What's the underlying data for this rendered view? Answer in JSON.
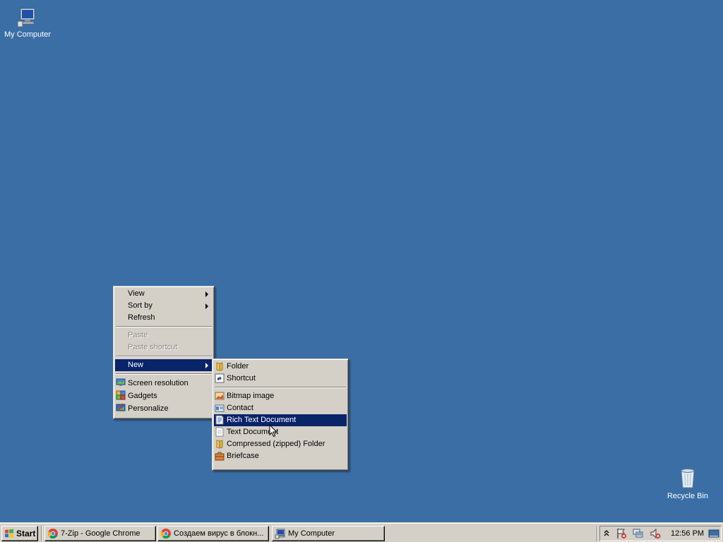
{
  "desktop": {
    "icons": {
      "my_computer": "My Computer",
      "recycle_bin": "Recycle Bin"
    },
    "background_color": "#3a6ea5"
  },
  "context_menu": {
    "view": "View",
    "sort_by": "Sort by",
    "refresh": "Refresh",
    "paste": "Paste",
    "paste_shortcut": "Paste shortcut",
    "new": "New",
    "screen_resolution": "Screen resolution",
    "gadgets": "Gadgets",
    "personalize": "Personalize"
  },
  "new_submenu": {
    "folder": "Folder",
    "shortcut": "Shortcut",
    "bitmap_image": "Bitmap image",
    "contact": "Contact",
    "rich_text_document": "Rich Text Document",
    "text_document": "Text Document",
    "compressed_folder": "Compressed (zipped) Folder",
    "briefcase": "Briefcase"
  },
  "taskbar": {
    "start": "Start",
    "tasks": {
      "t1": "7-Zip - Google Chrome",
      "t2": "Создаем вирус в блокн...",
      "t3": "My Computer"
    },
    "clock": "12:56 PM"
  },
  "colors": {
    "highlight": "#0a246a",
    "menu_bg": "#d4d0c8"
  }
}
